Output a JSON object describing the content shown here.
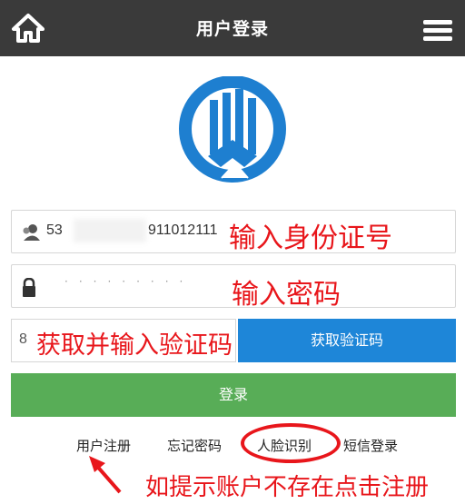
{
  "header": {
    "title": "用户登录",
    "home_icon": "home-icon",
    "menu_icon": "hamburger-menu-icon",
    "bg_color": "#3a3a3a"
  },
  "logo": {
    "icon": "bank-logo",
    "color": "#1e7fd0"
  },
  "form": {
    "id_number": {
      "value_prefix": "53",
      "value_suffix": "911012111",
      "icon": "user-icon"
    },
    "password": {
      "value": "·········",
      "icon": "lock-icon"
    },
    "sms_code": {
      "value": "8",
      "button_label": "获取验证码"
    },
    "login_button": "登录"
  },
  "annotations": {
    "id_hint": "输入身份证号",
    "password_hint": "输入密码",
    "code_hint": "获取并输入验证码",
    "register_hint": "如提示账户不存在点击注册"
  },
  "links": {
    "register": "用户注册",
    "forgot_password": "忘记密码",
    "face_recognition": "人脸识别",
    "sms_login": "短信登录"
  },
  "colors": {
    "accent_blue": "#1e86d8",
    "login_green": "#58ad57",
    "annotation_red": "#e8161b"
  }
}
